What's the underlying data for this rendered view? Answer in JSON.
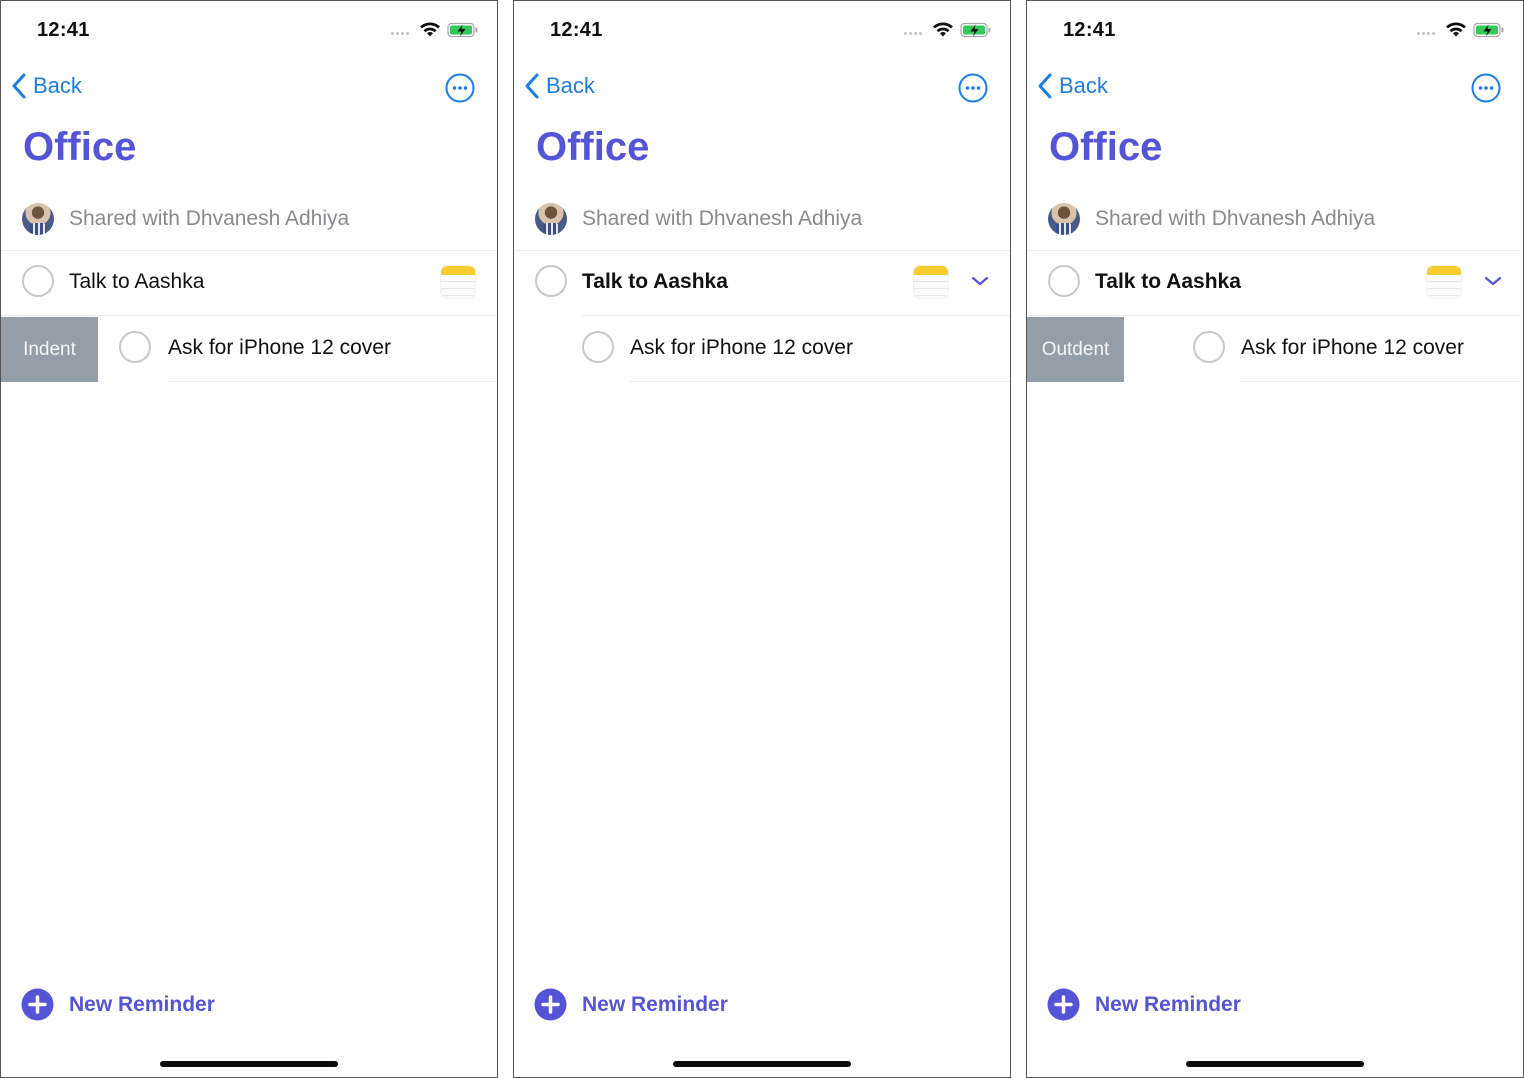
{
  "colors": {
    "accent_purple": "#5454d6",
    "link_blue": "#1a7ee6",
    "swipe_action_bg": "#939ea8",
    "notes_yellow": "#f8cd2f",
    "battery_green": "#34c759"
  },
  "panels": [
    {
      "status_bar": {
        "time": "12:41",
        "icons": [
          "signal-dots-icon",
          "wifi-icon",
          "battery-charging-icon"
        ]
      },
      "nav": {
        "back_label": "Back",
        "more_icon": "ellipsis-circle-icon"
      },
      "list_title": "Office",
      "shared_with": "Shared with Dhvanesh Adhiya",
      "reminders": [
        {
          "title": "Talk to Aashka",
          "has_notes_icon": true,
          "expanded_chevron": false,
          "bold": false
        },
        {
          "title": "Ask for iPhone 12 cover",
          "swipe_action": "Indent"
        }
      ],
      "new_reminder_label": "New Reminder"
    },
    {
      "status_bar": {
        "time": "12:41",
        "icons": [
          "signal-dots-icon",
          "wifi-icon",
          "battery-charging-icon"
        ]
      },
      "nav": {
        "back_label": "Back",
        "more_icon": "ellipsis-circle-icon"
      },
      "list_title": "Office",
      "shared_with": "Shared with Dhvanesh Adhiya",
      "reminders": [
        {
          "title": "Talk to Aashka",
          "has_notes_icon": true,
          "expanded_chevron": true,
          "bold": true
        },
        {
          "title": "Ask for iPhone 12 cover",
          "subtask": true
        }
      ],
      "new_reminder_label": "New Reminder"
    },
    {
      "status_bar": {
        "time": "12:41",
        "icons": [
          "signal-dots-icon",
          "wifi-icon",
          "battery-charging-icon"
        ]
      },
      "nav": {
        "back_label": "Back",
        "more_icon": "ellipsis-circle-icon"
      },
      "list_title": "Office",
      "shared_with": "Shared with Dhvanesh Adhiya",
      "reminders": [
        {
          "title": "Talk to Aashka",
          "has_notes_icon": true,
          "expanded_chevron": true,
          "bold": true
        },
        {
          "title": "Ask for iPhone 12 cover",
          "subtask": true,
          "swipe_action": "Outdent"
        }
      ],
      "new_reminder_label": "New Reminder"
    }
  ]
}
